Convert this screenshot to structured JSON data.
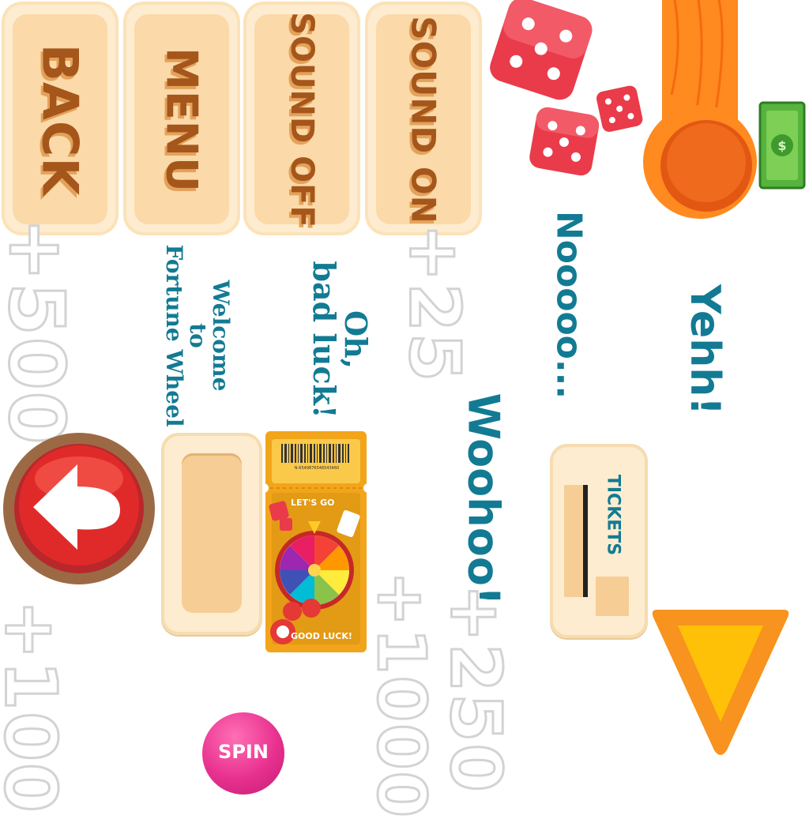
{
  "menu_buttons": [
    {
      "label": "BACK"
    },
    {
      "label": "MENU"
    },
    {
      "label": "SOUND OFF"
    },
    {
      "label": "SOUND ON"
    }
  ],
  "messages": {
    "welcome_line1": "Welcome",
    "welcome_line2": "to",
    "welcome_line3": "Fortune Wheel",
    "bad_luck_line1": "Oh,",
    "bad_luck_line2": "bad luck!",
    "nooo": "Nooooo...",
    "yehh": "Yehh!",
    "woohoo": "Woohoo!"
  },
  "rewards": [
    "+500",
    "+25",
    "+100",
    "+1000",
    "+250"
  ],
  "tickets_panel": {
    "label": "TICKETS"
  },
  "ticket_card": {
    "barcode_number": "N-6549876546543460",
    "lets_go": "LET'S GO",
    "good_luck": "GOOD LUCK!"
  },
  "spin_button": {
    "label": "SPIN"
  },
  "icons": [
    "dice-icon",
    "cash-icon",
    "back-arrow-icon",
    "pointer-triangle-icon",
    "thermometer-gauge-icon",
    "fortune-wheel-icon"
  ],
  "colors": {
    "teal_text": "#127b93",
    "button_text": "#a5561b",
    "spin_pink": "#e8318f",
    "arrow_red": "#e02a2a",
    "triangle_orange": "#f7931e",
    "ticket_gold": "#f2a51a"
  }
}
